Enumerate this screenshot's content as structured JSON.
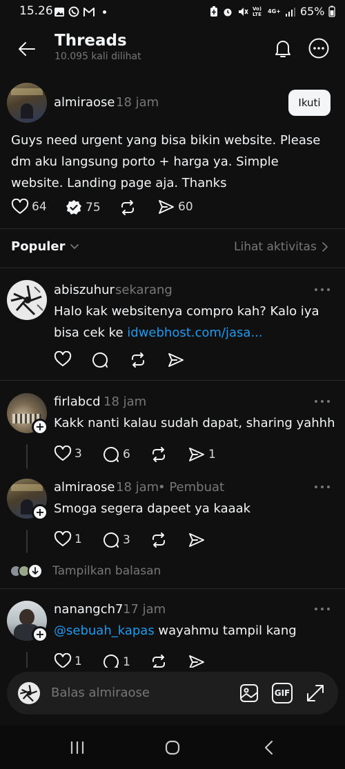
{
  "status_bar": {
    "time": "15.26",
    "network_label": "Vo) LTE",
    "signal_label": "4G+",
    "battery": "65%"
  },
  "header": {
    "title": "Threads",
    "subtitle": "10.095 kali dilihat"
  },
  "post": {
    "username": "almiraose",
    "time": "18 jam",
    "follow_label": "Ikuti",
    "text": "Guys need urgent yang bisa bikin website. Please dm aku langsung porto + harga ya. Simple website. Landing page aja. Thanks",
    "likes": "64",
    "replies": "75",
    "shares": "60"
  },
  "sort_bar": {
    "label": "Populer",
    "activity_link": "Lihat aktivitas"
  },
  "replies": [
    {
      "username": "abiszuhur",
      "time": "sekarang",
      "text_before": "Halo kak websitenya compro kah? Kalo iya bisa cek ke ",
      "link": "idwebhost.com/jasa..."
    },
    {
      "username": "firlabcd",
      "time": "18 jam",
      "text": "Kakk nanti kalau sudah dapat, sharing yahhh",
      "likes": "3",
      "comments": "6",
      "shares": "1"
    },
    {
      "username": "almiraose",
      "time": "18 jam",
      "author_tag": "• Pembuat",
      "text": "Smoga segera dapeet ya kaaak",
      "likes": "1",
      "comments": "3"
    },
    {
      "username": "nanangch7",
      "time": "17 jam",
      "mention": "@sebuah_kapas",
      "text": " wayahmu tampil kang",
      "likes": "1",
      "comments": "1"
    }
  ],
  "show_replies_label": "Tampilkan balasan",
  "reply_bar": {
    "placeholder": "Balas almiraose",
    "gif_label": "GIF"
  },
  "colors": {
    "background": "#101010",
    "text": "#f3f5f7",
    "muted": "#777777",
    "link": "#1d9bf0"
  }
}
